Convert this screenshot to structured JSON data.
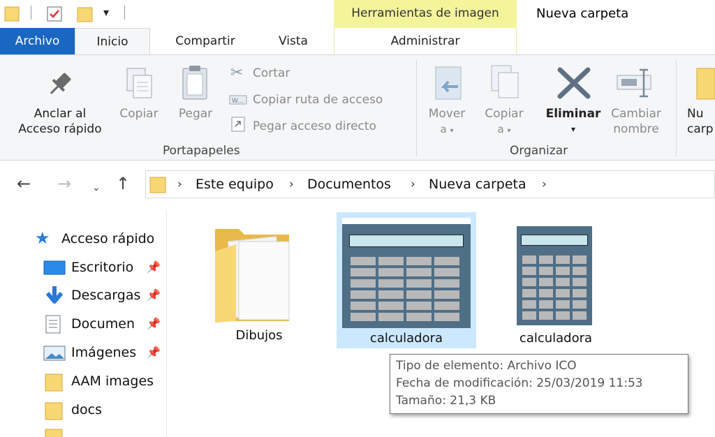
{
  "window": {
    "title": "Nueva carpeta",
    "context_tab": "Herramientas de imagen"
  },
  "tabs": [
    {
      "label": "Archivo",
      "active": false
    },
    {
      "label": "Inicio",
      "active": true
    },
    {
      "label": "Compartir",
      "active": false
    },
    {
      "label": "Vista",
      "active": false
    },
    {
      "label": "Administrar",
      "active": false
    }
  ],
  "ribbon": {
    "portapapeles": {
      "pin_line1": "Anclar al",
      "pin_line2": "Acceso rápido",
      "copy": "Copiar",
      "paste": "Pegar",
      "cut": "Cortar",
      "copy_path": "Copiar ruta de acceso",
      "paste_shortcut": "Pegar acceso directo",
      "group": "Portapapeles"
    },
    "organizar": {
      "move_line1": "Mover",
      "move_line2": "a",
      "copyto_line1": "Copiar",
      "copyto_line2": "a",
      "delete": "Eliminar",
      "rename_line1": "Cambiar",
      "rename_line2": "nombre",
      "group": "Organizar"
    },
    "nuevo": {
      "line1": "Nu",
      "line2": "carp"
    }
  },
  "breadcrumb": [
    "Este equipo",
    "Documentos",
    "Nueva carpeta"
  ],
  "nav_pane": {
    "quick_access": "Acceso rápido",
    "items": [
      {
        "label": "Escritorio",
        "pinned": true
      },
      {
        "label": "Descargas",
        "pinned": true
      },
      {
        "label": "Documen",
        "pinned": true
      },
      {
        "label": "Imágenes",
        "pinned": true
      },
      {
        "label": "AAM images",
        "pinned": false
      },
      {
        "label": "docs",
        "pinned": false
      }
    ]
  },
  "files": [
    {
      "name": "Dibujos",
      "type": "folder"
    },
    {
      "name": "calculadora",
      "type": "image",
      "selected": true
    },
    {
      "name": "calculadora",
      "type": "image",
      "selected": false
    }
  ],
  "tooltip": {
    "type": "Tipo de elemento: Archivo ICO",
    "modified": "Fecha de modificación: 25/03/2019 11:53",
    "size": "Tamaño: 21,3 KB"
  },
  "colors": {
    "archivo_tab": "#1a67c2",
    "context_tab": "#f4f59b",
    "selection": "#cce8ff",
    "folder": "#f8d775"
  }
}
